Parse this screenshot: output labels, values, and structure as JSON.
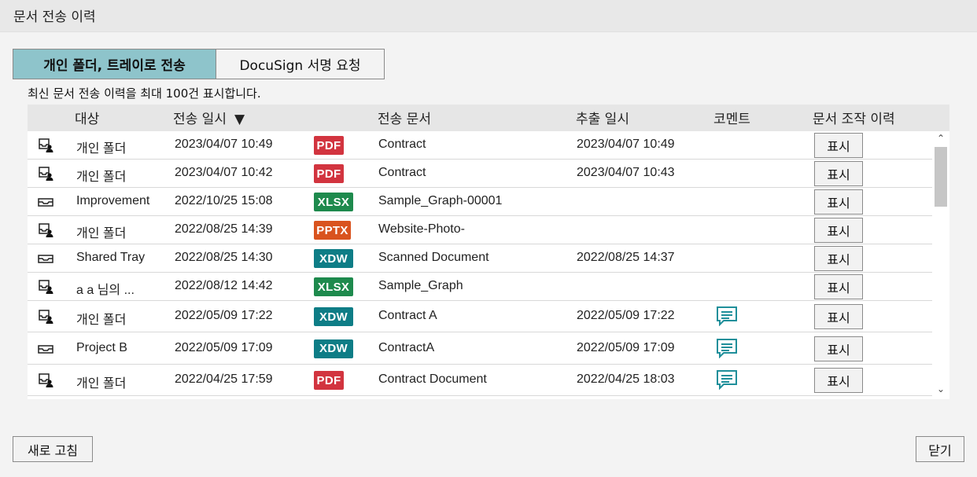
{
  "window": {
    "title": "문서 전송 이력"
  },
  "tabs": [
    {
      "label": "개인 폴더, 트레이로 전송",
      "active": true
    },
    {
      "label": "DocuSign 서명 요청",
      "active": false
    }
  ],
  "info_text": "최신 문서 전송 이력을 최대 100건 표시합니다.",
  "columns": {
    "target": "대상",
    "sent_at": "전송 일시",
    "sort_indicator": "▼",
    "document": "전송 문서",
    "extracted_at": "추출 일시",
    "comment": "코멘트",
    "history": "문서 조작 이력"
  },
  "rows": [
    {
      "icon": "personal-folder-icon",
      "target": "개인 폴더",
      "sent_at": "2023/04/07 10:49",
      "type": "PDF",
      "document": "Contract",
      "extracted_at": "2023/04/07 10:49",
      "comment": false,
      "button": "표시"
    },
    {
      "icon": "personal-folder-icon",
      "target": "개인 폴더",
      "sent_at": "2023/04/07 10:42",
      "type": "PDF",
      "document": "Contract",
      "extracted_at": "2023/04/07 10:43",
      "comment": false,
      "button": "표시"
    },
    {
      "icon": "tray-icon",
      "target": "Improvement",
      "sent_at": "2022/10/25 15:08",
      "type": "XLSX",
      "document": "Sample_Graph-00001",
      "extracted_at": "",
      "comment": false,
      "button": "표시"
    },
    {
      "icon": "personal-folder-icon",
      "target": "개인 폴더",
      "sent_at": "2022/08/25 14:39",
      "type": "PPTX",
      "document": "Website-Photo-",
      "extracted_at": "",
      "comment": false,
      "button": "표시"
    },
    {
      "icon": "tray-icon",
      "target": "Shared Tray",
      "sent_at": "2022/08/25 14:30",
      "type": "XDW",
      "document": "Scanned Document",
      "extracted_at": "2022/08/25 14:37",
      "comment": false,
      "button": "표시"
    },
    {
      "icon": "personal-folder-icon",
      "target": "a a 님의 ...",
      "sent_at": "2022/08/12 14:42",
      "type": "XLSX",
      "document": "Sample_Graph",
      "extracted_at": "",
      "comment": false,
      "button": "표시"
    },
    {
      "icon": "personal-folder-icon",
      "target": "개인 폴더",
      "sent_at": "2022/05/09 17:22",
      "type": "XDW",
      "document": "Contract A",
      "extracted_at": "2022/05/09 17:22",
      "comment": true,
      "button": "표시"
    },
    {
      "icon": "tray-icon",
      "target": "Project B",
      "sent_at": "2022/05/09 17:09",
      "type": "XDW",
      "document": "ContractA",
      "extracted_at": "2022/05/09 17:09",
      "comment": true,
      "button": "표시"
    },
    {
      "icon": "personal-folder-icon",
      "target": "개인 폴더",
      "sent_at": "2022/04/25 17:59",
      "type": "PDF",
      "document": "Contract Document",
      "extracted_at": "2022/04/25 18:03",
      "comment": true,
      "button": "표시"
    },
    {
      "icon": "tray-icon",
      "target": "",
      "sent_at": "",
      "type": "",
      "document": "",
      "extracted_at": "",
      "comment": true,
      "button": ""
    }
  ],
  "type_colors": {
    "PDF": "#d2343f",
    "XLSX": "#1e8a4d",
    "PPTX": "#d9531e",
    "XDW": "#0e7d86"
  },
  "comment_color": "#1f8f9a",
  "buttons": {
    "refresh": "새로 고침",
    "close": "닫기"
  }
}
